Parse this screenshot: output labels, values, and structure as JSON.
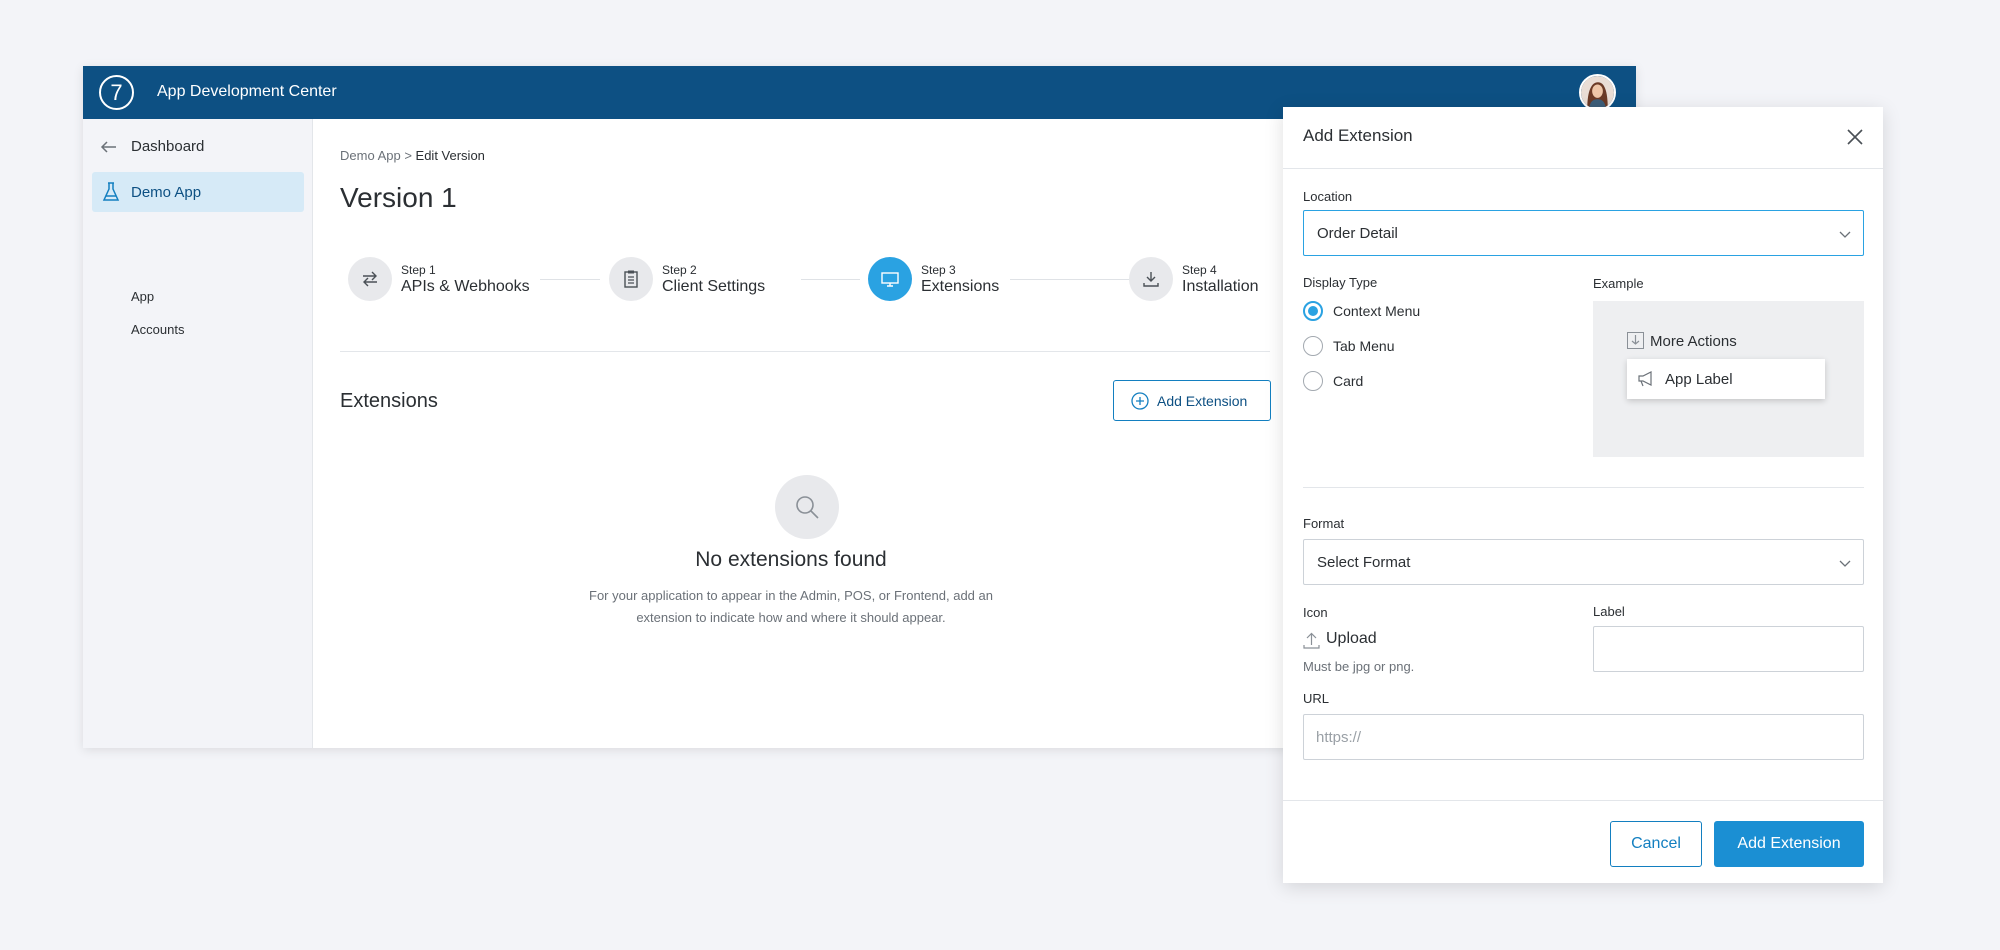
{
  "header": {
    "app_title": "App Development Center",
    "logo_mark": "7"
  },
  "sidebar": {
    "dashboard_label": "Dashboard",
    "active_app_label": "Demo App",
    "sub_items": [
      "App",
      "Accounts"
    ]
  },
  "breadcrumb": {
    "parent": "Demo App",
    "separator": " > ",
    "current": "Edit Version"
  },
  "page_title": "Version 1",
  "steps": [
    {
      "num": "Step 1",
      "name": "APIs & Webhooks",
      "icon": "arrows-swap-icon",
      "active": false
    },
    {
      "num": "Step 2",
      "name": "Client Settings",
      "icon": "clipboard-icon",
      "active": false
    },
    {
      "num": "Step 3",
      "name": "Extensions",
      "icon": "monitor-icon",
      "active": true
    },
    {
      "num": "Step 4",
      "name": "Installation",
      "icon": "download-icon",
      "active": false
    }
  ],
  "extensions": {
    "heading": "Extensions",
    "add_button_label": "Add Extension",
    "empty_title": "No extensions found",
    "empty_desc": "For your application to appear in the Admin, POS, or Frontend, add an extension to indicate how and where it should appear."
  },
  "modal": {
    "title": "Add Extension",
    "location_label": "Location",
    "location_value": "Order Detail",
    "display_type_label": "Display Type",
    "display_types": [
      {
        "label": "Context Menu",
        "checked": true
      },
      {
        "label": "Tab Menu",
        "checked": false
      },
      {
        "label": "Card",
        "checked": false
      }
    ],
    "example_label": "Example",
    "example_more_actions": "More Actions",
    "example_app_label": "App Label",
    "format_label": "Format",
    "format_value": "Select Format",
    "icon_label": "Icon",
    "upload_label": "Upload",
    "upload_hint": "Must be jpg or png.",
    "label_field_label": "Label",
    "label_value": "",
    "url_label": "URL",
    "url_placeholder": "https://",
    "cancel_label": "Cancel",
    "submit_label": "Add Extension"
  },
  "colors": {
    "topbar": "#0d5083",
    "accent": "#2aa2e2",
    "primary_button": "#1b8fd3",
    "sidebar_active_bg": "#d6eaf7"
  }
}
